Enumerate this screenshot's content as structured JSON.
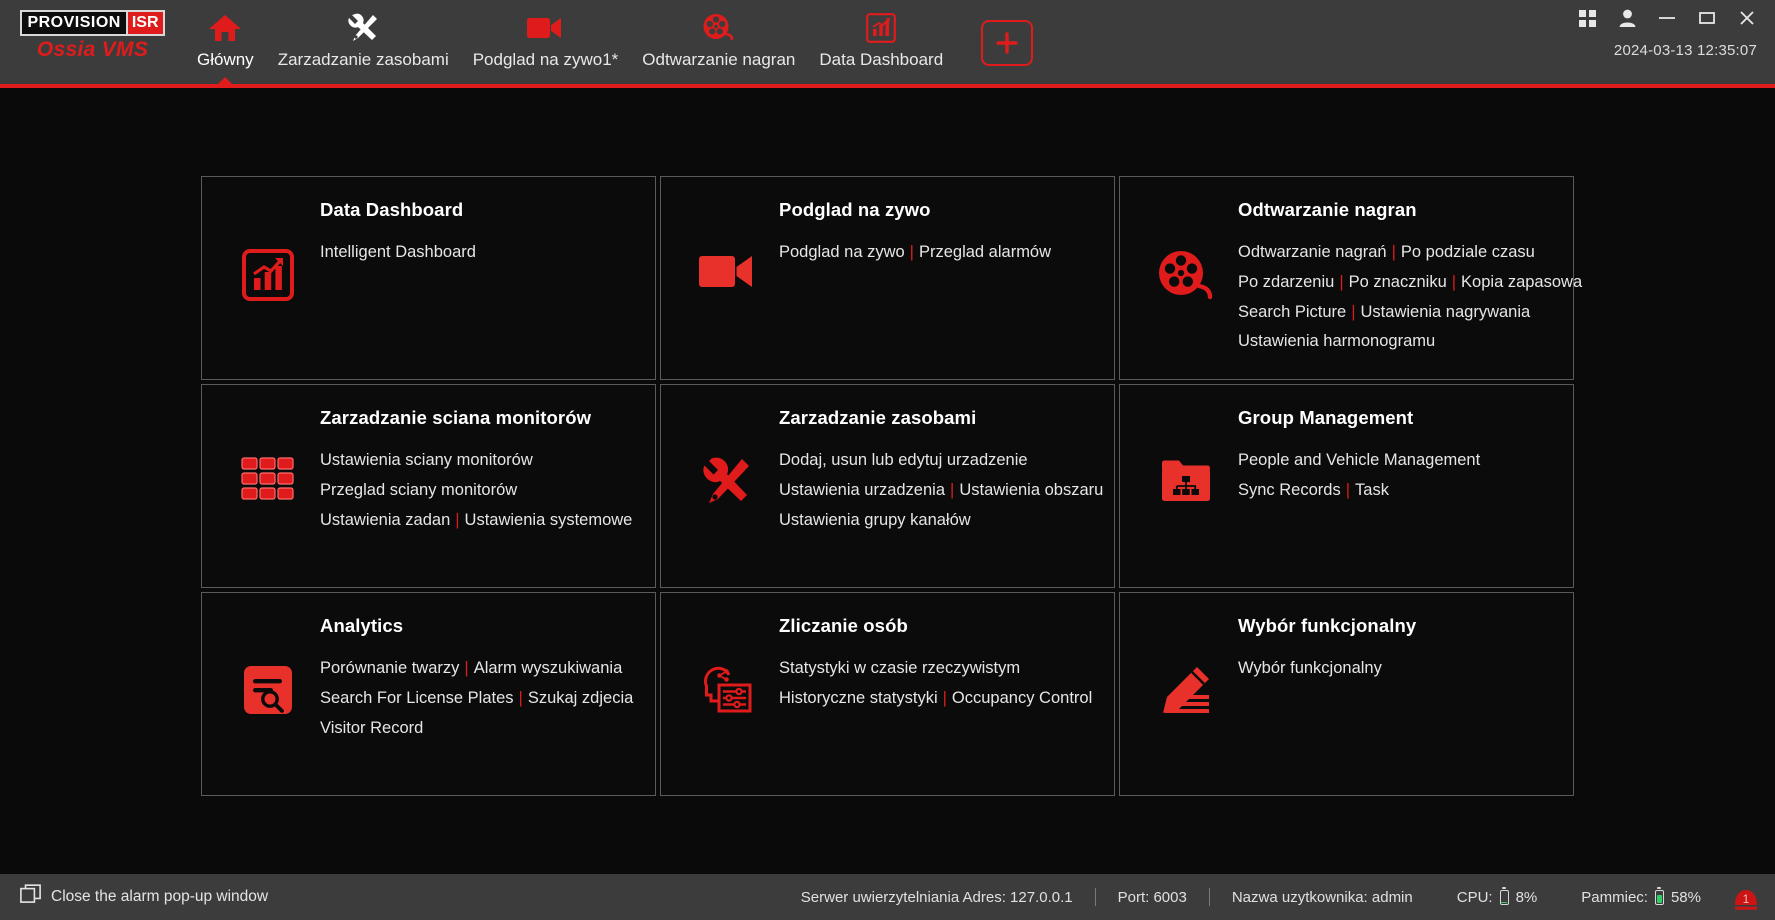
{
  "brand": {
    "logo_main": "PROVISION",
    "logo_badge": "ISR",
    "logo_sub": "Ossia VMS"
  },
  "colors": {
    "accent": "#e01b1b",
    "header_bg": "#3c3c3c",
    "page_bg": "#0a0a0a",
    "card_bg": "#0b0b0b",
    "card_border": "#5a5a5a",
    "memory_gauge": "#2fd06a"
  },
  "header": {
    "tabs": [
      {
        "label": "Główny",
        "icon": "home-icon",
        "active": true
      },
      {
        "label": "Zarzadzanie zasobami",
        "icon": "tools-icon",
        "active": false
      },
      {
        "label": "Podglad na zywo1*",
        "icon": "video-camera-icon",
        "active": false
      },
      {
        "label": "Odtwarzanie nagran",
        "icon": "film-reel-icon",
        "active": false
      },
      {
        "label": "Data Dashboard",
        "icon": "bar-chart-icon",
        "active": false
      }
    ],
    "add_tab_label": "+",
    "clock": "2024-03-13 12:35:07",
    "window_controls": [
      {
        "name": "apps-grid-icon"
      },
      {
        "name": "user-account-icon"
      },
      {
        "name": "minimize-icon"
      },
      {
        "name": "maximize-icon"
      },
      {
        "name": "close-icon"
      }
    ]
  },
  "cards": [
    {
      "id": "data-dashboard",
      "title": "Data Dashboard",
      "icon": "bar-chart-icon",
      "rows": [
        {
          "links": [
            "Intelligent Dashboard"
          ]
        }
      ]
    },
    {
      "id": "podglad-na-zywo",
      "title": "Podglad na zywo",
      "icon": "video-camera-icon",
      "rows": [
        {
          "links": [
            "Podglad na zywo",
            "Przeglad alarmów"
          ]
        }
      ]
    },
    {
      "id": "odtwarzanie-nagran",
      "title": "Odtwarzanie nagran",
      "icon": "film-reel-icon",
      "rows": [
        {
          "links": [
            "Odtwarzanie nagrań",
            "Po podziale czasu"
          ]
        },
        {
          "links": [
            "Po zdarzeniu",
            "Po znaczniku",
            "Kopia zapasowa"
          ]
        },
        {
          "links": [
            "Search Picture",
            "Ustawienia nagrywania"
          ]
        },
        {
          "links": [
            "Ustawienia harmonogramu"
          ]
        }
      ]
    },
    {
      "id": "zarzadzanie-sciana-monitorow",
      "title": "Zarzadzanie sciana monitorów",
      "icon": "video-wall-icon",
      "rows": [
        {
          "links": [
            "Ustawienia sciany monitorów"
          ]
        },
        {
          "links": [
            "Przeglad sciany monitorów"
          ]
        },
        {
          "links": [
            "Ustawienia zadan",
            "Ustawienia systemowe"
          ]
        }
      ]
    },
    {
      "id": "zarzadzanie-zasobami",
      "title": "Zarzadzanie zasobami",
      "icon": "tools-icon",
      "rows": [
        {
          "links": [
            "Dodaj, usun lub edytuj urzadzenie"
          ]
        },
        {
          "links": [
            "Ustawienia urzadzenia",
            "Ustawienia obszaru"
          ]
        },
        {
          "links": [
            "Ustawienia grupy kanałów"
          ]
        }
      ]
    },
    {
      "id": "group-management",
      "title": "Group Management",
      "icon": "folder-hierarchy-icon",
      "rows": [
        {
          "links": [
            "People and Vehicle Management"
          ]
        },
        {
          "links": [
            "Sync Records",
            "Task"
          ]
        }
      ]
    },
    {
      "id": "analytics",
      "title": "Analytics",
      "icon": "document-search-icon",
      "rows": [
        {
          "links": [
            "Porównanie twarzy",
            "Alarm wyszukiwania"
          ]
        },
        {
          "links": [
            "Search For License Plates",
            "Szukaj zdjecia"
          ]
        },
        {
          "links": [
            "Visitor Record"
          ]
        }
      ]
    },
    {
      "id": "zliczanie-osob",
      "title": "Zliczanie osób",
      "icon": "people-counting-icon",
      "rows": [
        {
          "links": [
            "Statystyki w czasie rzeczywistym"
          ]
        },
        {
          "links": [
            "Historyczne statystyki",
            "Occupancy Control"
          ]
        }
      ]
    },
    {
      "id": "wybor-funkcjonalny",
      "title": "Wybór funkcjonalny",
      "icon": "pencil-edit-icon",
      "rows": [
        {
          "links": [
            "Wybór funkcjonalny"
          ]
        }
      ]
    }
  ],
  "statusbar": {
    "close_alarm_label": "Close the alarm pop-up window",
    "auth_server": "Serwer uwierzytelniania Adres: 127.0.0.1",
    "port": "Port: 6003",
    "username": "Nazwa uzytkownika: admin",
    "cpu_label": "CPU:",
    "cpu_value": "8%",
    "cpu_percent": 8,
    "memory_label": "Pammiec:",
    "memory_value": "58%",
    "memory_percent": 58,
    "alarm_count": "1"
  }
}
